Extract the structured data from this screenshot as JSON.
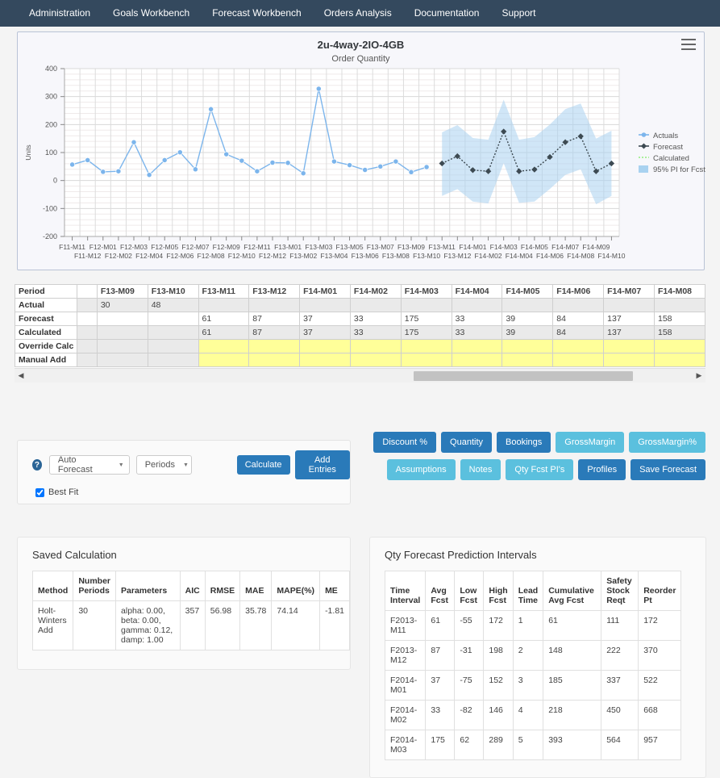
{
  "nav": {
    "items": [
      {
        "label": "Administration"
      },
      {
        "label": "Goals Workbench"
      },
      {
        "label": "Forecast Workbench"
      },
      {
        "label": "Orders Analysis"
      },
      {
        "label": "Documentation"
      },
      {
        "label": "Support"
      }
    ]
  },
  "chart_panel": {
    "title": "2u-4way-2IO-4GB",
    "subtitle": "Order Quantity",
    "menu_icon": "hamburger-icon"
  },
  "chart_data": {
    "type": "line",
    "title": "2u-4way-2IO-4GB",
    "subtitle": "Order Quantity",
    "xlabel": "",
    "ylabel": "Units",
    "ylim": [
      -200,
      400
    ],
    "yticks": [
      -200,
      -100,
      0,
      100,
      200,
      300,
      400
    ],
    "grid": true,
    "legend_position": "right",
    "legend": [
      "Actuals",
      "Forecast",
      "Calculated",
      "95% PI for Fcst"
    ],
    "colors": {
      "actuals": "#7cb5ec",
      "forecast": "#3d4a52",
      "calculated": "#90ed7d",
      "pi_band": "#a9d2f0"
    },
    "categories": [
      "F11-M11",
      "F11-M12",
      "F12-M01",
      "F12-M02",
      "F12-M03",
      "F12-M04",
      "F12-M05",
      "F12-M06",
      "F12-M07",
      "F12-M08",
      "F12-M09",
      "F12-M10",
      "F12-M11",
      "F12-M12",
      "F13-M01",
      "F13-M02",
      "F13-M03",
      "F13-M04",
      "F13-M05",
      "F13-M06",
      "F13-M07",
      "F13-M08",
      "F13-M09",
      "F13-M10",
      "F13-M11",
      "F13-M12",
      "F14-M01",
      "F14-M02",
      "F14-M03",
      "F14-M04",
      "F14-M05",
      "F14-M06",
      "F14-M07",
      "F14-M08",
      "F14-M09",
      "F14-M10"
    ],
    "series": [
      {
        "name": "Actuals",
        "values": [
          57,
          73,
          31,
          33,
          137,
          20,
          73,
          101,
          40,
          255,
          94,
          71,
          33,
          64,
          63,
          26,
          328,
          68,
          55,
          38,
          50,
          68,
          30,
          48,
          null,
          null,
          null,
          null,
          null,
          null,
          null,
          null,
          null,
          null,
          null,
          null
        ]
      },
      {
        "name": "Forecast",
        "values": [
          null,
          null,
          null,
          null,
          null,
          null,
          null,
          null,
          null,
          null,
          null,
          null,
          null,
          null,
          null,
          null,
          null,
          null,
          null,
          null,
          null,
          null,
          null,
          null,
          61,
          87,
          37,
          33,
          175,
          33,
          39,
          84,
          137,
          158,
          33,
          61
        ]
      },
      {
        "name": "Calculated",
        "values": [
          null,
          null,
          null,
          null,
          null,
          null,
          null,
          null,
          null,
          null,
          null,
          null,
          null,
          null,
          null,
          null,
          null,
          null,
          null,
          null,
          null,
          null,
          null,
          null,
          61,
          87,
          37,
          33,
          175,
          33,
          39,
          84,
          137,
          158,
          33,
          61
        ]
      },
      {
        "name": "95% PI for Fcst Low",
        "values": [
          null,
          null,
          null,
          null,
          null,
          null,
          null,
          null,
          null,
          null,
          null,
          null,
          null,
          null,
          null,
          null,
          null,
          null,
          null,
          null,
          null,
          null,
          null,
          null,
          -55,
          -31,
          -75,
          -82,
          62,
          -80,
          -75,
          -30,
          20,
          40,
          -85,
          -55
        ]
      },
      {
        "name": "95% PI for Fcst High",
        "values": [
          null,
          null,
          null,
          null,
          null,
          null,
          null,
          null,
          null,
          null,
          null,
          null,
          null,
          null,
          null,
          null,
          null,
          null,
          null,
          null,
          null,
          null,
          null,
          null,
          172,
          198,
          152,
          146,
          289,
          146,
          155,
          200,
          255,
          275,
          150,
          178
        ]
      }
    ]
  },
  "grid_table": {
    "row_labels": [
      "Period",
      "Actual",
      "Forecast",
      "Calculated",
      "Override Calc",
      "Manual Add"
    ],
    "columns": [
      "F13-M09",
      "F13-M10",
      "F13-M11",
      "F13-M12",
      "F14-M01",
      "F14-M02",
      "F14-M03",
      "F14-M04",
      "F14-M05",
      "F14-M06",
      "F14-M07",
      "F14-M08"
    ],
    "actual": [
      "30",
      "48",
      "",
      "",
      "",
      "",
      "",
      "",
      "",
      "",
      "",
      ""
    ],
    "forecast": [
      "",
      "",
      "61",
      "87",
      "37",
      "33",
      "175",
      "33",
      "39",
      "84",
      "137",
      "158"
    ],
    "calculated": [
      "",
      "",
      "61",
      "87",
      "37",
      "33",
      "175",
      "33",
      "39",
      "84",
      "137",
      "158"
    ],
    "override": [
      "",
      "",
      "",
      "",
      "",
      "",
      "",
      "",
      "",
      "",
      "",
      ""
    ],
    "manual_add": [
      "",
      "",
      "",
      "",
      "",
      "",
      "",
      "",
      "",
      "",
      "",
      ""
    ],
    "scroll_left_icon": "triangle-left-icon",
    "scroll_right_icon": "triangle-right-icon"
  },
  "controls": {
    "help_icon": "question-mark-icon",
    "method_select": "Auto Forecast",
    "periods_select": "Periods",
    "calculate_label": "Calculate",
    "add_entries_label": "Add Entries",
    "best_fit_label": "Best Fit",
    "best_fit_checked": true
  },
  "actions": {
    "row1": [
      {
        "label": "Discount %",
        "style": "dark"
      },
      {
        "label": "Quantity",
        "style": "dark"
      },
      {
        "label": "Bookings",
        "style": "dark"
      },
      {
        "label": "GrossMargin",
        "style": "light"
      },
      {
        "label": "GrossMargin%",
        "style": "light"
      }
    ],
    "row2": [
      {
        "label": "Assumptions",
        "style": "light"
      },
      {
        "label": "Notes",
        "style": "light"
      },
      {
        "label": "Qty Fcst PI's",
        "style": "light"
      },
      {
        "label": "Profiles",
        "style": "dark"
      },
      {
        "label": "Save Forecast",
        "style": "dark"
      }
    ]
  },
  "saved_calculation": {
    "title": "Saved Calculation",
    "headers": [
      "Method",
      "Number Periods",
      "Parameters",
      "AIC",
      "RMSE",
      "MAE",
      "MAPE(%)",
      "ME"
    ],
    "rows": [
      {
        "method": "Holt-Winters Add",
        "periods": "30",
        "parameters": "alpha: 0.00, beta: 0.00, gamma: 0.12, damp: 1.00",
        "aic": "357",
        "rmse": "56.98",
        "mae": "35.78",
        "mape": "74.14",
        "me": "-1.81"
      }
    ]
  },
  "prediction_intervals": {
    "title": "Qty Forecast Prediction Intervals",
    "headers": [
      "Time Interval",
      "Avg Fcst",
      "Low Fcst",
      "High Fcst",
      "Lead Time",
      "Cumulative Avg Fcst",
      "Safety Stock Reqt",
      "Reorder Pt"
    ],
    "rows": [
      {
        "interval": "F2013-M11",
        "avg": "61",
        "low": "-55",
        "high": "172",
        "lead": "1",
        "cum": "61",
        "safety": "111",
        "reorder": "172"
      },
      {
        "interval": "F2013-M12",
        "avg": "87",
        "low": "-31",
        "high": "198",
        "lead": "2",
        "cum": "148",
        "safety": "222",
        "reorder": "370"
      },
      {
        "interval": "F2014-M01",
        "avg": "37",
        "low": "-75",
        "high": "152",
        "lead": "3",
        "cum": "185",
        "safety": "337",
        "reorder": "522"
      },
      {
        "interval": "F2014-M02",
        "avg": "33",
        "low": "-82",
        "high": "146",
        "lead": "4",
        "cum": "218",
        "safety": "450",
        "reorder": "668"
      },
      {
        "interval": "F2014-M03",
        "avg": "175",
        "low": "62",
        "high": "289",
        "lead": "5",
        "cum": "393",
        "safety": "564",
        "reorder": "957"
      }
    ]
  }
}
